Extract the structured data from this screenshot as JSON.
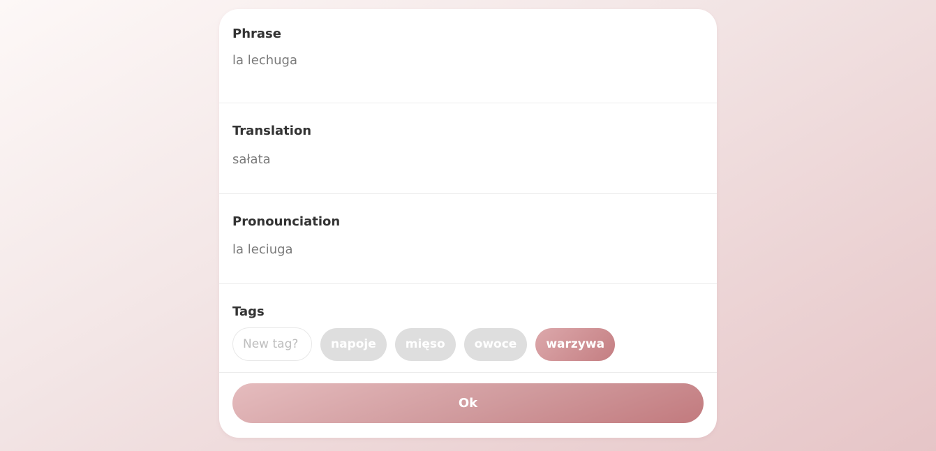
{
  "form": {
    "phrase": {
      "label": "Phrase",
      "value": "la lechuga"
    },
    "translation": {
      "label": "Translation",
      "value": "sałata"
    },
    "pronunciation": {
      "label": "Pronounciation",
      "value": "la leciuga"
    },
    "tags": {
      "label": "Tags",
      "new_tag_placeholder": "New tag?",
      "items": [
        {
          "label": "napoje",
          "selected": false
        },
        {
          "label": "mięso",
          "selected": false
        },
        {
          "label": "owoce",
          "selected": false
        },
        {
          "label": "warzywa",
          "selected": true
        }
      ]
    },
    "ok_label": "Ok"
  },
  "colors": {
    "selected_tag": "#c98a8e",
    "unselected_tag": "#dedede",
    "label_text": "#333333",
    "value_text": "#7a7a7a"
  }
}
